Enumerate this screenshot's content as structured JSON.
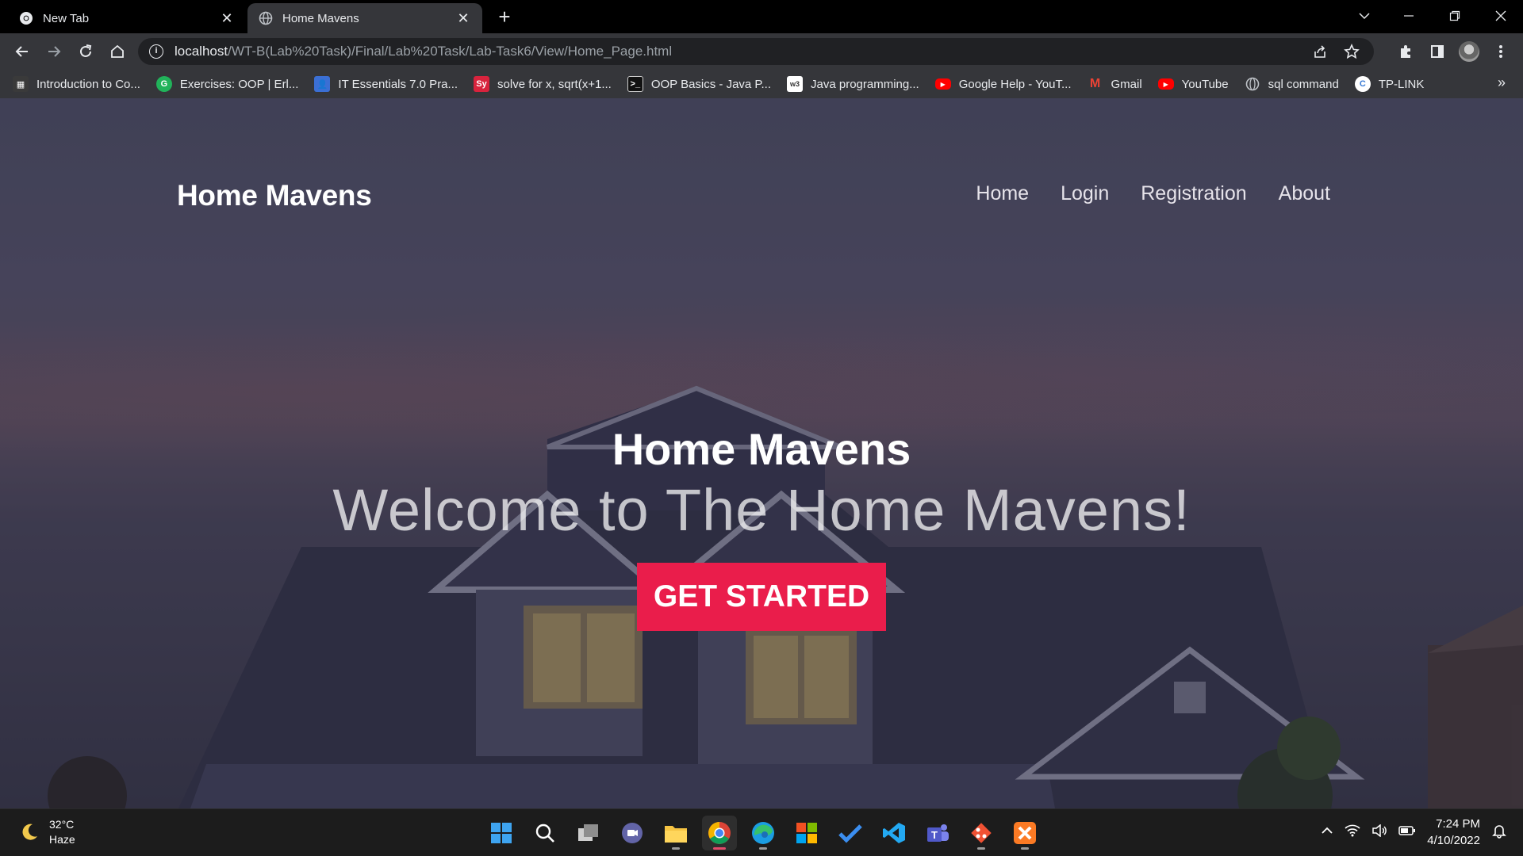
{
  "browser": {
    "tabs": [
      {
        "title": "New Tab",
        "active": false
      },
      {
        "title": "Home Mavens",
        "active": true
      }
    ],
    "url_host": "localhost",
    "url_path": "/WT-B(Lab%20Task)/Final/Lab%20Task/Lab-Task6/View/Home_Page.html",
    "bookmarks": [
      {
        "label": "Introduction to Co...",
        "icon": "bookmark-icon",
        "color": "#333333"
      },
      {
        "label": "Exercises: OOP | Erl...",
        "icon": "g-icon",
        "color": "#21b35a"
      },
      {
        "label": "IT Essentials 7.0 Pra...",
        "icon": "classroom-icon",
        "color": "#3b6fd4"
      },
      {
        "label": "solve for x, sqrt(x+1...",
        "icon": "symbolab-icon",
        "color": "#d8233d"
      },
      {
        "label": "OOP Basics - Java P...",
        "icon": "terminal-icon",
        "color": "#111111"
      },
      {
        "label": "Java programming...",
        "icon": "w3-icon",
        "color": "#ffffff"
      },
      {
        "label": "Google Help - YouT...",
        "icon": "youtube-icon",
        "color": "#ff0000"
      },
      {
        "label": "Gmail",
        "icon": "gmail-icon",
        "color": "#ea4335"
      },
      {
        "label": "YouTube",
        "icon": "youtube-icon",
        "color": "#ff0000"
      },
      {
        "label": "sql command",
        "icon": "globe-icon",
        "color": "#9aa0a6"
      },
      {
        "label": "TP-LINK",
        "icon": "tplink-icon",
        "color": "#3a7bd5"
      }
    ]
  },
  "site": {
    "logo": "Home Mavens",
    "nav": [
      "Home",
      "Login",
      "Registration",
      "About"
    ],
    "hero_title": "Home Mavens",
    "hero_subtitle": "Welcome to The Home Mavens!",
    "cta_label": "GET STARTED",
    "cta_color": "#ea1d4b"
  },
  "taskbar": {
    "temperature": "32°C",
    "condition": "Haze",
    "time": "7:24 PM",
    "date": "4/10/2022"
  }
}
